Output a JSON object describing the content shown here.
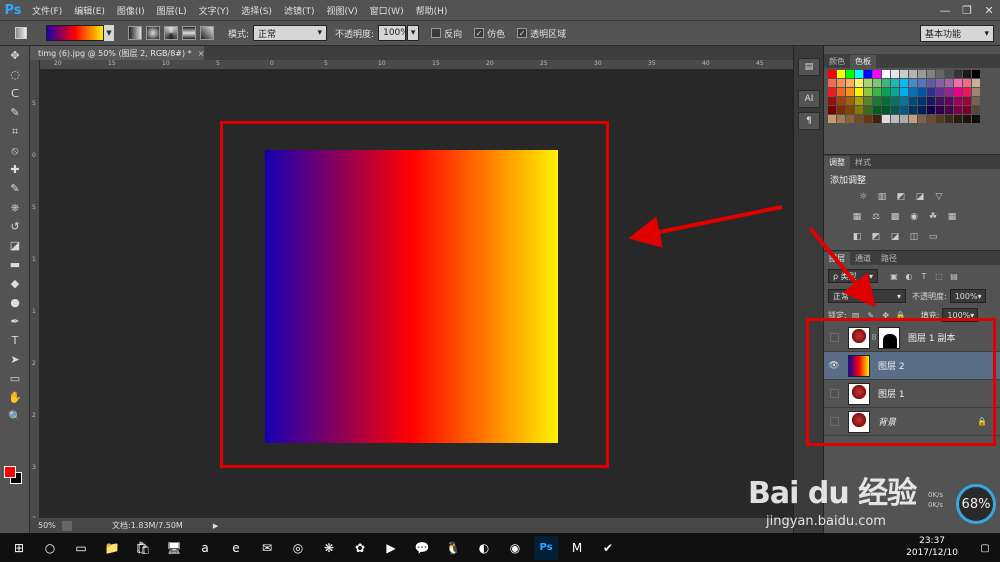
{
  "app": {
    "logo": "Ps"
  },
  "menu": [
    "文件(F)",
    "编辑(E)",
    "图像(I)",
    "图层(L)",
    "文字(Y)",
    "选择(S)",
    "滤镜(T)",
    "视图(V)",
    "窗口(W)",
    "帮助(H)"
  ],
  "window_controls": [
    "—",
    "❐",
    "✕"
  ],
  "options": {
    "mode_label": "模式:",
    "mode_value": "正常",
    "opacity_label": "不透明度:",
    "opacity_value": "100%",
    "reverse_label": "反向",
    "dither_label": "仿色",
    "transparency_label": "透明区域",
    "workspace": "基本功能"
  },
  "document": {
    "tab_title": "timg (6).jpg @ 50% (图层 2, RGB/8#) *",
    "tab_close": "×",
    "zoom": "50%",
    "doc_info": "文档:1.83M/7.50M",
    "status_arrow": "▶"
  },
  "rulers": {
    "top": [
      "20",
      "15",
      "10",
      "5",
      "0",
      "5",
      "10",
      "15",
      "20",
      "25",
      "30",
      "35",
      "40",
      "45"
    ],
    "left": [
      "5",
      "0",
      "5",
      "1",
      "1",
      "2",
      "2",
      "3",
      "3"
    ]
  },
  "tools": [
    "move-tool",
    "marquee-tool",
    "lasso-tool",
    "quick-select-tool",
    "crop-tool",
    "eyedropper-tool",
    "healing-tool",
    "brush-tool",
    "stamp-tool",
    "history-brush-tool",
    "eraser-tool",
    "gradient-tool",
    "blur-tool",
    "dodge-tool",
    "pen-tool",
    "type-tool",
    "path-select-tool",
    "shape-tool",
    "hand-tool",
    "zoom-tool"
  ],
  "tool_glyphs": [
    "✥",
    "◌",
    "ᑕ",
    "✎",
    "⌗",
    "⦸",
    "✚",
    "✎",
    "⎈",
    "↺",
    "◪",
    "▬",
    "◆",
    "●",
    "✒",
    "T",
    "➤",
    "▭",
    "✋",
    "🔍"
  ],
  "colors": {
    "foreground": "#ff0000",
    "background": "#000000",
    "highlight": "#e00000"
  },
  "panel_strip": [
    "▤",
    "AI",
    "¶"
  ],
  "swatches_panel": {
    "tabs": [
      "颜色",
      "色板"
    ],
    "colors": [
      "#ff0000",
      "#ffff00",
      "#00ff00",
      "#00ffff",
      "#0000ff",
      "#ff00ff",
      "#ffffff",
      "#e6e6e6",
      "#cccccc",
      "#b3b3b3",
      "#999999",
      "#808080",
      "#666666",
      "#4d4d4d",
      "#333333",
      "#1a1a1a",
      "#000000",
      "#f26c4f",
      "#f68e55",
      "#fbaf5c",
      "#fff467",
      "#acd372",
      "#7cc576",
      "#3bb878",
      "#1abbb4",
      "#00bff3",
      "#438ccb",
      "#5574b9",
      "#605ca8",
      "#855fa8",
      "#a763a8",
      "#f06ea9",
      "#f26d7d",
      "#c7b299",
      "#ed1c24",
      "#f26522",
      "#f7941d",
      "#fff200",
      "#8dc63f",
      "#39b54a",
      "#00a651",
      "#00a99d",
      "#00aeef",
      "#0072bc",
      "#0054a6",
      "#2e3192",
      "#662d91",
      "#92278f",
      "#ec008c",
      "#ed145b",
      "#998675",
      "#9e0b0f",
      "#a0410d",
      "#a3620a",
      "#aba000",
      "#598527",
      "#197b30",
      "#007236",
      "#00746b",
      "#0076a3",
      "#004a80",
      "#003471",
      "#1b1464",
      "#440e62",
      "#630460",
      "#9e005d",
      "#9e0039",
      "#736357",
      "#790000",
      "#7b2e00",
      "#7d4900",
      "#827b00",
      "#406618",
      "#005e20",
      "#005826",
      "#005952",
      "#005b7f",
      "#003663",
      "#002157",
      "#0d004c",
      "#32004b",
      "#4b0049",
      "#7b0046",
      "#7a0026",
      "#534741",
      "#c69c6d",
      "#a67c52",
      "#8c6239",
      "#754c24",
      "#603913",
      "#42210b",
      "#dddddd",
      "#bbbbbb",
      "#aaaaaa",
      "#c0a080",
      "#80604a",
      "#6e4b30",
      "#553a22",
      "#3d2a18",
      "#2a1c10",
      "#1f140b",
      "#140c06"
    ]
  },
  "adjustments_panel": {
    "tabs": [
      "调整",
      "样式"
    ],
    "title": "添加调整",
    "row1": [
      "☼",
      "▥",
      "◩",
      "◪",
      "▽"
    ],
    "row2": [
      "▦",
      "⚖",
      "▩",
      "◉",
      "☘",
      "▦"
    ],
    "row3": [
      "◧",
      "◩",
      "◪",
      "◫",
      "▭"
    ]
  },
  "layers_panel": {
    "tabs": [
      "图层",
      "通道",
      "路径"
    ],
    "filter_label": "ρ 类型",
    "filter_icons": [
      "▣",
      "◐",
      "T",
      "⬚",
      "▤"
    ],
    "blend_mode": "正常",
    "opacity_label": "不透明度:",
    "opacity_value": "100%",
    "lock_label": "锁定:",
    "lock_icons": [
      "▨",
      "✎",
      "✥",
      "🔒"
    ],
    "fill_label": "填充:",
    "fill_value": "100%",
    "layers": [
      {
        "name": "图层 1 副本",
        "visible": false,
        "selected": false,
        "thumb": "photo",
        "mask": true
      },
      {
        "name": "图层 2",
        "visible": true,
        "selected": true,
        "thumb": "gradient",
        "mask": false
      },
      {
        "name": "图层 1",
        "visible": false,
        "selected": false,
        "thumb": "photo",
        "mask": false
      },
      {
        "name": "背景",
        "visible": false,
        "selected": false,
        "thumb": "photo",
        "mask": false,
        "locked": true
      }
    ],
    "eye_glyph": "👁",
    "lock_glyph": "🔒",
    "chain_glyph": "8"
  },
  "watermark": {
    "logo": "Bai du 经验",
    "url": "jingyan.baidu.com"
  },
  "net_widget": {
    "percent": "68%",
    "up": "0K/s",
    "down": "0K/s"
  },
  "taskbar": {
    "icons": [
      "⊞",
      "○",
      "▭",
      "📁",
      "🛍",
      "🖥",
      "a",
      "e",
      "✉",
      "◎",
      "❋",
      "✿",
      "▶",
      "💬",
      "🐧",
      "◐",
      "◉",
      "Ps",
      "M",
      "✔"
    ],
    "time": "23:37",
    "date": "2017/12/10",
    "notify": "▢"
  }
}
